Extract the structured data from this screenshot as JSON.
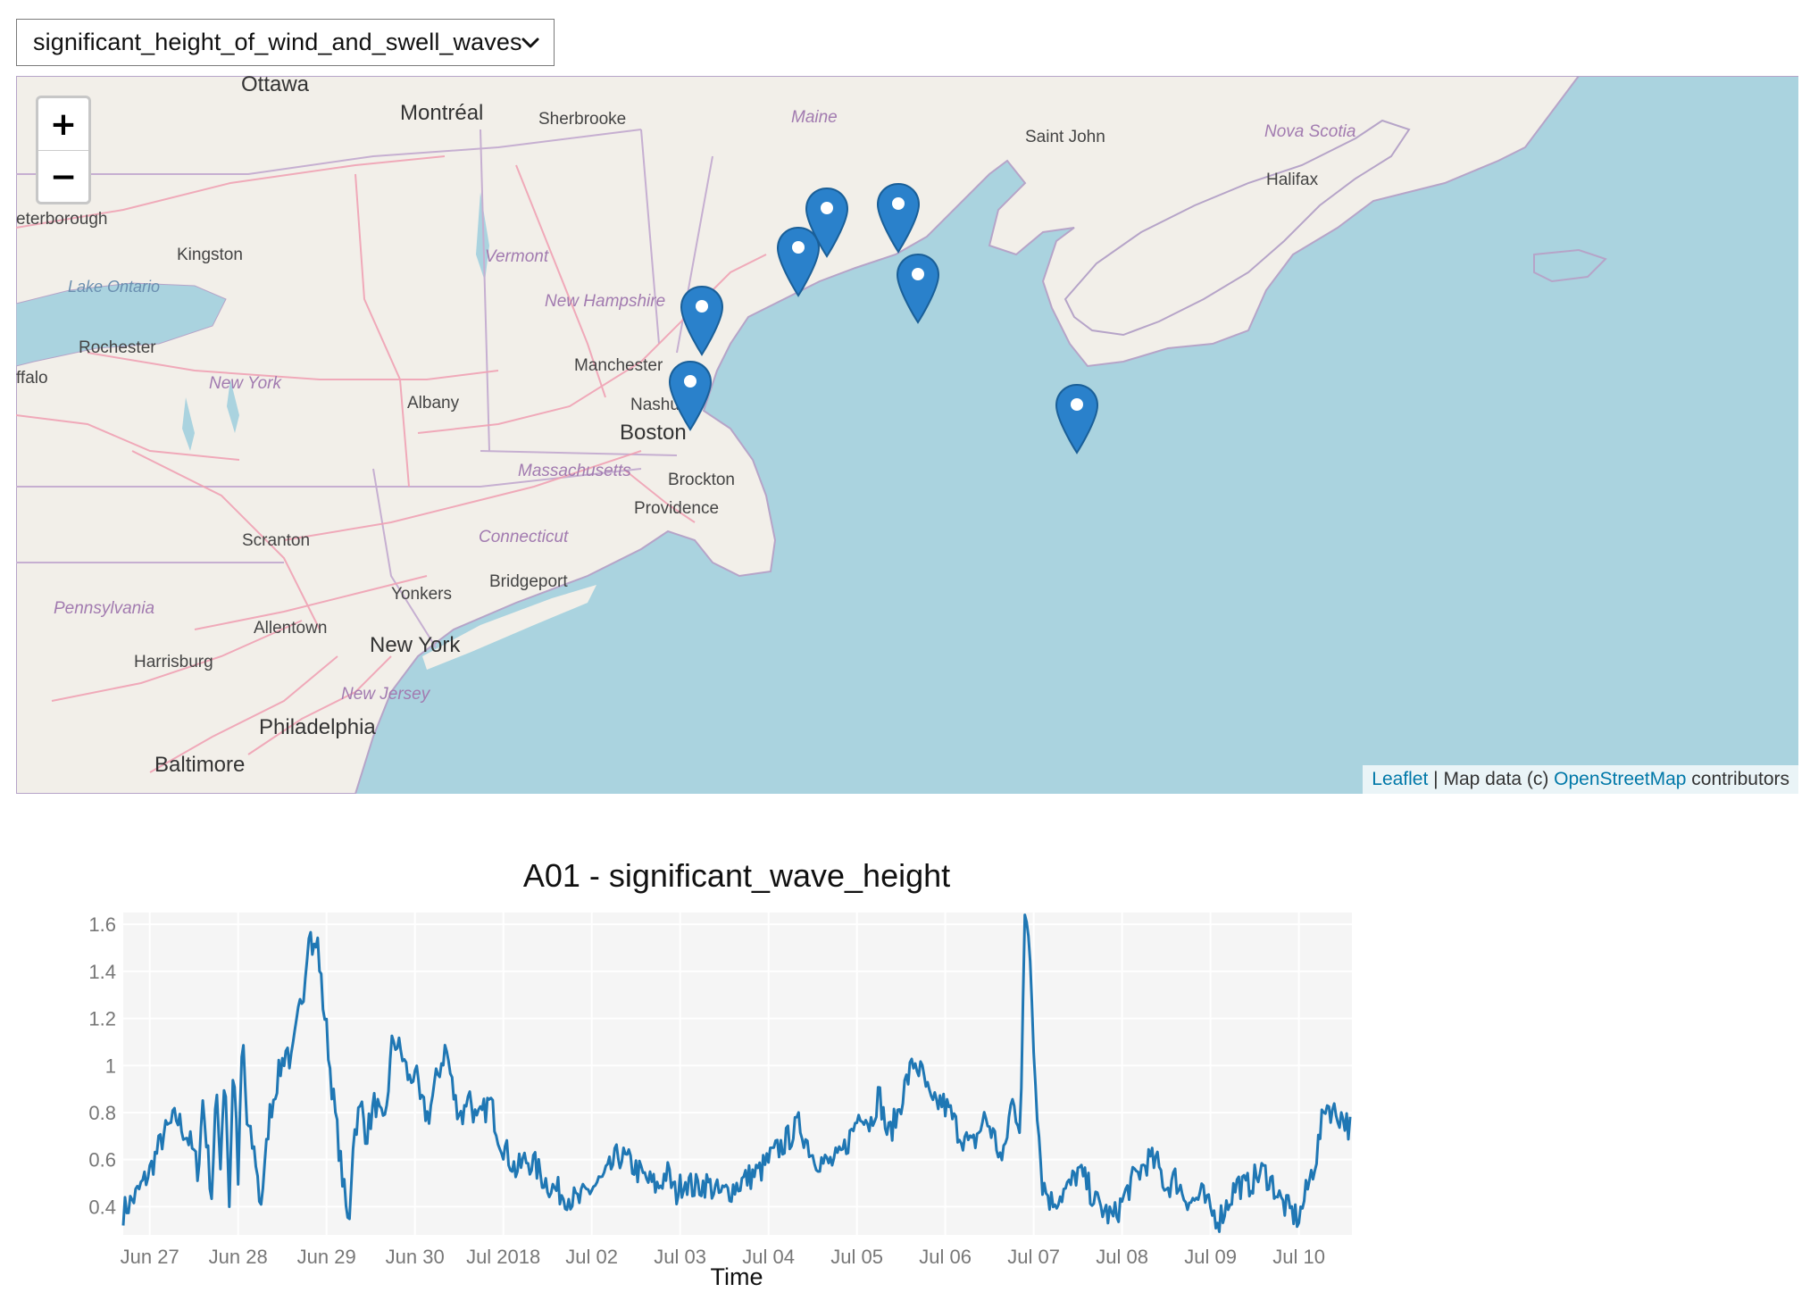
{
  "dropdown": {
    "selected": "significant_height_of_wind_and_swell_waves"
  },
  "map": {
    "zoom_in_label": "+",
    "zoom_out_label": "−",
    "attribution": {
      "leaflet": "Leaflet",
      "middle": " | Map data (c) ",
      "osm": "OpenStreetMap",
      "suffix": " contributors"
    },
    "labels": {
      "ottawa": "Ottawa",
      "montreal": "Montréal",
      "sherbrooke": "Sherbrooke",
      "maine": "Maine",
      "saint_john": "Saint John",
      "nova_scotia": "Nova Scotia",
      "halifax": "Halifax",
      "peterborough": "eterborough",
      "kingston": "Kingston",
      "lake_ontario": "Lake Ontario",
      "vermont": "Vermont",
      "new_hampshire": "New Hampshire",
      "rochester": "Rochester",
      "buffalo": "ffalo",
      "new_york_state": "New York",
      "manchester": "Manchester",
      "nashua": "Nashu",
      "albany": "Albany",
      "boston": "Boston",
      "massachusetts": "Massachusetts",
      "brockton": "Brockton",
      "providence": "Providence",
      "scranton": "Scranton",
      "connecticut": "Connecticut",
      "bridgeport": "Bridgeport",
      "yonkers": "Yonkers",
      "pennsylvania": "Pennsylvania",
      "allentown": "Allentown",
      "new_york_city": "New York",
      "harrisburg": "Harrisburg",
      "new_jersey": "New Jersey",
      "philadelphia": "Philadelphia",
      "baltimore": "Baltimore"
    },
    "marker_count": 7
  },
  "chart_data": {
    "type": "line",
    "title": "A01 - significant_wave_height",
    "xlabel": "Time",
    "ylabel": "",
    "ylim": [
      0.28,
      1.65
    ],
    "yticks": [
      "0.4",
      "0.6",
      "0.8",
      "1",
      "1.2",
      "1.4",
      "1.6"
    ],
    "xtick_labels": [
      "Jun 27",
      "Jun 28",
      "Jun 29",
      "Jun 30",
      "Jul 2018",
      "Jul 02",
      "Jul 03",
      "Jul 04",
      "Jul 05",
      "Jul 06",
      "Jul 07",
      "Jul 08",
      "Jul 09",
      "Jul 10"
    ],
    "xlim_days": [
      26.7,
      40.6
    ],
    "grid": true,
    "color": "#1f77b4",
    "series": [
      {
        "x_days": [
          26.7,
          26.85,
          27.0,
          27.15,
          27.3,
          27.45,
          27.55,
          27.6,
          27.7,
          27.75,
          27.8,
          27.85,
          27.9,
          27.95,
          28.0,
          28.05,
          28.1,
          28.2,
          28.25,
          28.3,
          28.35,
          28.45,
          28.55,
          28.6,
          28.7,
          28.75,
          28.8,
          28.85,
          28.9,
          28.95,
          29.0,
          29.05,
          29.15,
          29.25,
          29.3,
          29.35,
          29.4,
          29.45,
          29.55,
          29.65,
          29.75,
          29.85,
          29.95,
          30.0,
          30.05,
          30.15,
          30.25,
          30.35,
          30.45,
          30.55,
          30.6,
          30.7,
          30.85,
          30.95,
          31.05,
          31.15,
          31.25,
          31.35,
          31.45,
          31.55,
          31.7,
          31.85,
          32.0,
          32.15,
          32.3,
          32.45,
          32.6,
          32.75,
          32.85,
          32.95,
          33.05,
          33.15,
          33.3,
          33.45,
          33.6,
          33.75,
          33.9,
          34.05,
          34.2,
          34.35,
          34.5,
          34.65,
          34.8,
          34.95,
          35.05,
          35.15,
          35.25,
          35.35,
          35.45,
          35.55,
          35.65,
          35.75,
          35.85,
          35.95,
          36.05,
          36.15,
          36.3,
          36.45,
          36.55,
          36.65,
          36.75,
          36.85,
          36.9,
          36.95,
          37.0,
          37.05,
          37.1,
          37.2,
          37.3,
          37.4,
          37.5,
          37.6,
          37.7,
          37.8,
          37.9,
          38.0,
          38.1,
          38.2,
          38.3,
          38.4,
          38.5,
          38.6,
          38.7,
          38.8,
          38.9,
          39.0,
          39.1,
          39.2,
          39.3,
          39.4,
          39.5,
          39.6,
          39.7,
          39.8,
          39.9,
          40.0,
          40.1,
          40.2,
          40.3,
          40.4,
          40.5,
          40.6
        ],
        "y": [
          0.38,
          0.45,
          0.55,
          0.7,
          0.78,
          0.68,
          0.55,
          0.85,
          0.45,
          0.88,
          0.6,
          1.0,
          0.42,
          1.05,
          0.5,
          1.15,
          0.75,
          0.6,
          0.4,
          0.55,
          0.78,
          0.95,
          1.08,
          1.0,
          1.25,
          1.35,
          1.6,
          1.48,
          1.52,
          1.3,
          1.15,
          0.95,
          0.62,
          0.3,
          0.68,
          0.78,
          0.82,
          0.7,
          0.85,
          0.72,
          1.12,
          1.05,
          0.92,
          1.0,
          0.85,
          0.78,
          0.95,
          1.08,
          0.85,
          0.78,
          0.9,
          0.75,
          0.85,
          0.7,
          0.62,
          0.55,
          0.6,
          0.58,
          0.52,
          0.48,
          0.45,
          0.42,
          0.48,
          0.52,
          0.62,
          0.58,
          0.52,
          0.48,
          0.55,
          0.45,
          0.52,
          0.48,
          0.5,
          0.45,
          0.48,
          0.52,
          0.55,
          0.62,
          0.68,
          0.75,
          0.62,
          0.58,
          0.6,
          0.72,
          0.82,
          0.75,
          0.88,
          0.7,
          0.78,
          0.92,
          1.02,
          0.95,
          0.82,
          0.85,
          0.8,
          0.72,
          0.65,
          0.78,
          0.7,
          0.58,
          0.85,
          0.75,
          1.62,
          1.55,
          1.1,
          0.75,
          0.5,
          0.42,
          0.45,
          0.48,
          0.55,
          0.5,
          0.42,
          0.38,
          0.35,
          0.42,
          0.5,
          0.55,
          0.6,
          0.58,
          0.48,
          0.52,
          0.45,
          0.42,
          0.45,
          0.38,
          0.35,
          0.42,
          0.5,
          0.48,
          0.52,
          0.55,
          0.5,
          0.42,
          0.38,
          0.35,
          0.48,
          0.62,
          0.84,
          0.8,
          0.78,
          0.72,
          0.62,
          0.52,
          0.5,
          0.48
        ],
        "noise_amplitude": 0.06
      }
    ]
  }
}
